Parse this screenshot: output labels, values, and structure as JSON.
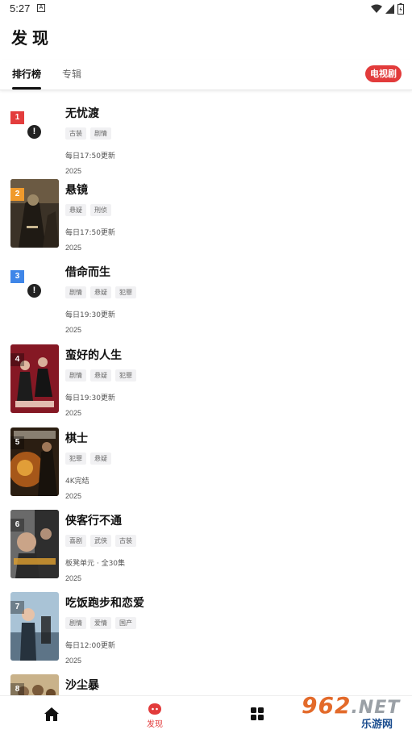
{
  "status": {
    "time": "5:27",
    "notif_letter": "A"
  },
  "header": {
    "title": "发现"
  },
  "tabs": {
    "rank": "排行榜",
    "album": "专辑",
    "category_badge": "电视剧"
  },
  "items": [
    {
      "rank": "1",
      "rank_color": "#e33d3d",
      "title": "无忧渡",
      "tags": [
        "古装",
        "剧情"
      ],
      "update": "每日17:50更新",
      "year": "2025",
      "poster": "error"
    },
    {
      "rank": "2",
      "rank_color": "#f09a2c",
      "title": "悬镜",
      "tags": [
        "悬疑",
        "刑侦"
      ],
      "update": "每日17:50更新",
      "year": "2025",
      "poster": "image"
    },
    {
      "rank": "3",
      "rank_color": "#3f86e8",
      "title": "借命而生",
      "tags": [
        "剧情",
        "悬疑",
        "犯罪"
      ],
      "update": "每日19:30更新",
      "year": "2025",
      "poster": "error"
    },
    {
      "rank": "4",
      "rank_color": "rgba(0,0,0,0.35)",
      "title": "蛮好的人生",
      "tags": [
        "剧情",
        "悬疑",
        "犯罪"
      ],
      "update": "每日19:30更新",
      "year": "2025",
      "poster": "image"
    },
    {
      "rank": "5",
      "rank_color": "rgba(0,0,0,0.35)",
      "title": "棋士",
      "tags": [
        "犯罪",
        "悬疑"
      ],
      "update": "4K完结",
      "year": "2025",
      "poster": "image"
    },
    {
      "rank": "6",
      "rank_color": "rgba(0,0,0,0.35)",
      "title": "侠客行不通",
      "tags": [
        "喜剧",
        "武侠",
        "古装"
      ],
      "update": "板凳单元 · 全30集",
      "year": "2025",
      "poster": "image"
    },
    {
      "rank": "7",
      "rank_color": "rgba(0,0,0,0.35)",
      "title": "吃饭跑步和恋爱",
      "tags": [
        "剧情",
        "爱情",
        "国产"
      ],
      "update": "每日12:00更新",
      "year": "2025",
      "poster": "image"
    },
    {
      "rank": "8",
      "rank_color": "rgba(0,0,0,0.35)",
      "title": "沙尘暴",
      "tags": [],
      "update": "",
      "year": "",
      "poster": "image"
    }
  ],
  "bottom_nav": {
    "discover_label": "发现",
    "active_color": "#e23b3b"
  },
  "watermark": {
    "main": "962",
    "net": ".NET",
    "sub": "乐游网"
  }
}
